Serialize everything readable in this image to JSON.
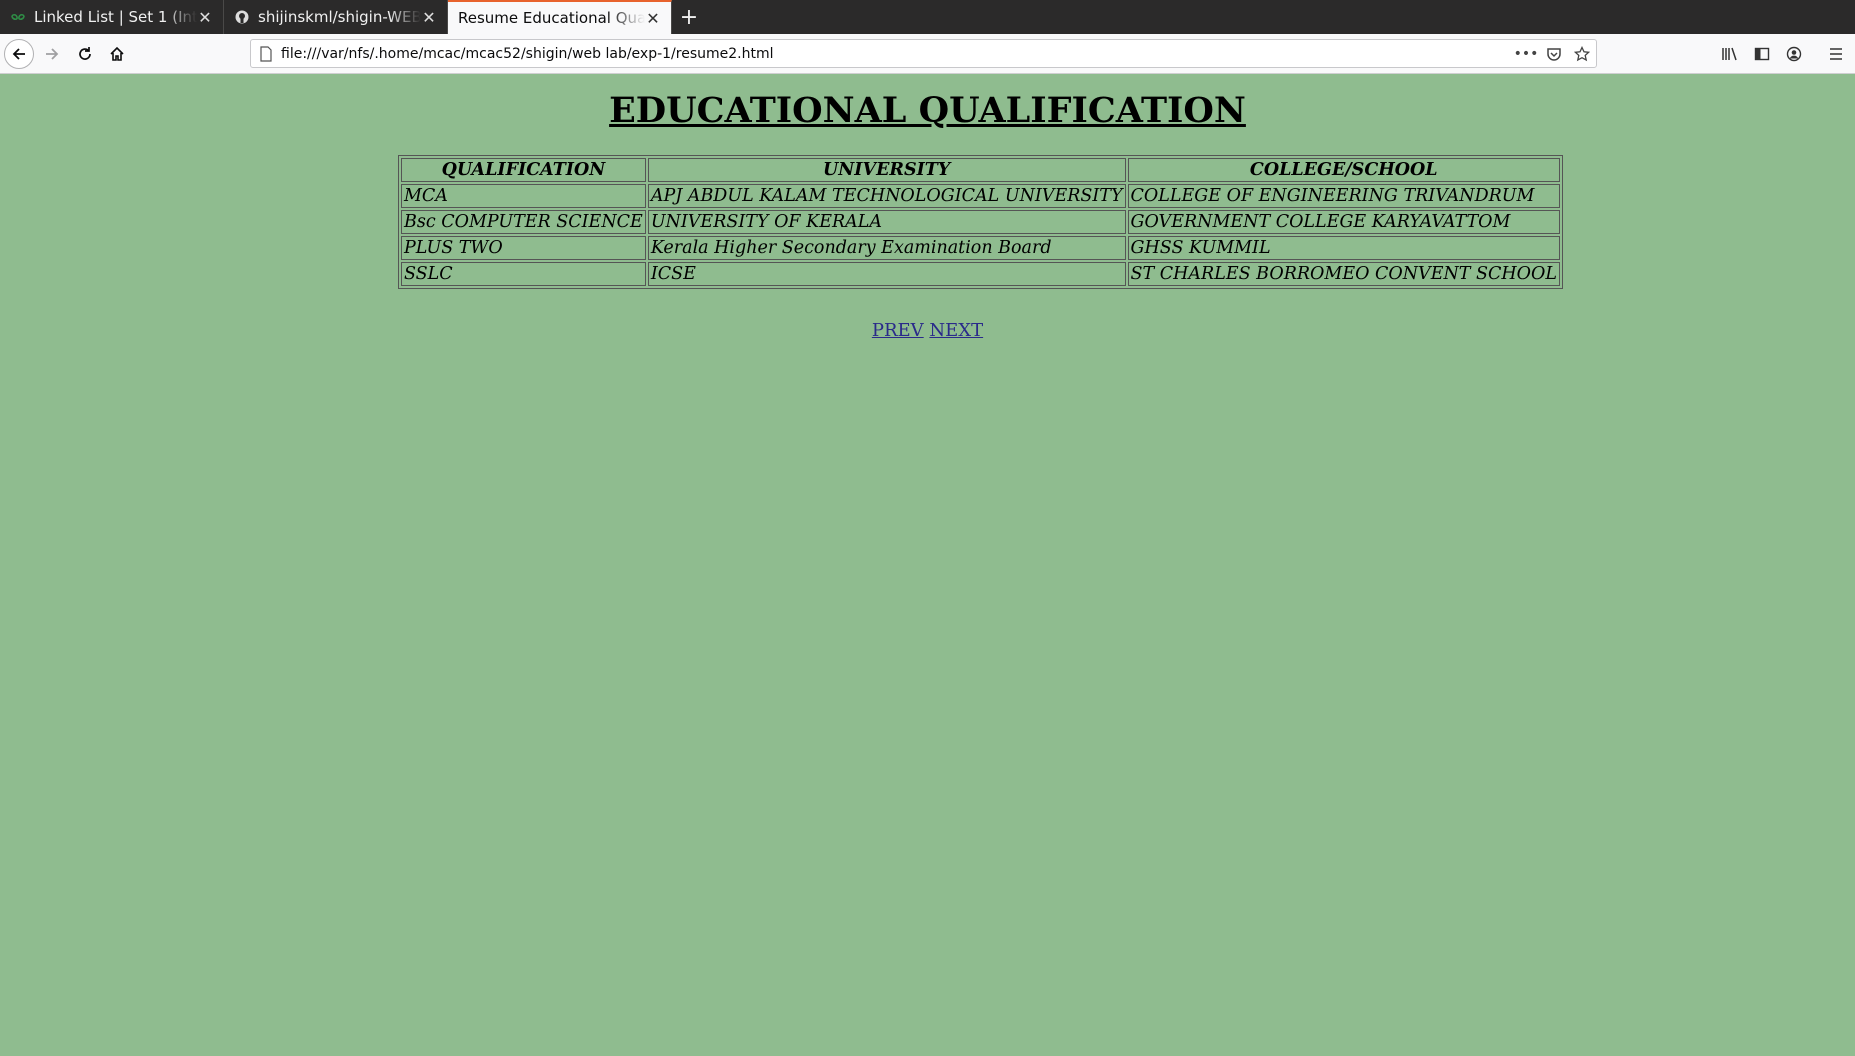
{
  "browser": {
    "tabs": [
      {
        "title": "Linked List | Set 1 (Introduction)",
        "icon": "geeksforgeeks-icon",
        "active": false
      },
      {
        "title": "shijinskml/shigin-WEB-lab",
        "icon": "github-icon",
        "active": false
      },
      {
        "title": "Resume Educational Qualification",
        "icon": "none",
        "active": true
      }
    ],
    "url": "file:///var/nfs/.home/mcac/mcac52/shigin/web lab/exp-1/resume2.html"
  },
  "page": {
    "heading": "EDUCATIONAL QUALIFICATION",
    "table": {
      "headers": [
        "QUALIFICATION",
        "UNIVERSITY",
        "COLLEGE/SCHOOL"
      ],
      "rows": [
        [
          "MCA",
          "APJ ABDUL KALAM TECHNOLOGICAL UNIVERSITY",
          "COLLEGE OF ENGINEERING TRIVANDRUM"
        ],
        [
          "Bsc COMPUTER SCIENCE",
          "UNIVERSITY OF KERALA",
          "GOVERNMENT COLLEGE KARYAVATTOM"
        ],
        [
          "PLUS TWO",
          "Kerala Higher Secondary Examination Board",
          "GHSS KUMMIL"
        ],
        [
          "SSLC",
          "ICSE",
          "ST CHARLES BORROMEO CONVENT SCHOOL"
        ]
      ]
    },
    "links": {
      "prev": "PREV",
      "next": "NEXT"
    }
  },
  "colors": {
    "page_background": "#8fbc8f",
    "active_tab_accent": "#e8632d"
  }
}
